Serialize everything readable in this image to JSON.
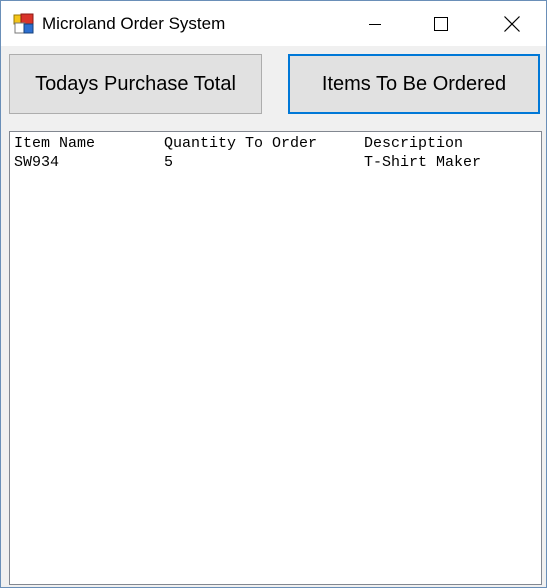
{
  "window": {
    "title": "Microland Order System",
    "icon": "app-icon",
    "controls": {
      "minimize_icon": "minimize-icon",
      "maximize_icon": "maximize-icon",
      "close_icon": "close-icon"
    },
    "accent_color": "#0078d7"
  },
  "buttons": {
    "todays_purchase_total": "Todays Purchase Total",
    "items_to_be_ordered": "Items To Be Ordered"
  },
  "list": {
    "columns": [
      "Item Name",
      "Quantity To Order",
      "Description"
    ],
    "rows": [
      [
        "SW934",
        "5",
        "T-Shirt Maker"
      ]
    ]
  }
}
